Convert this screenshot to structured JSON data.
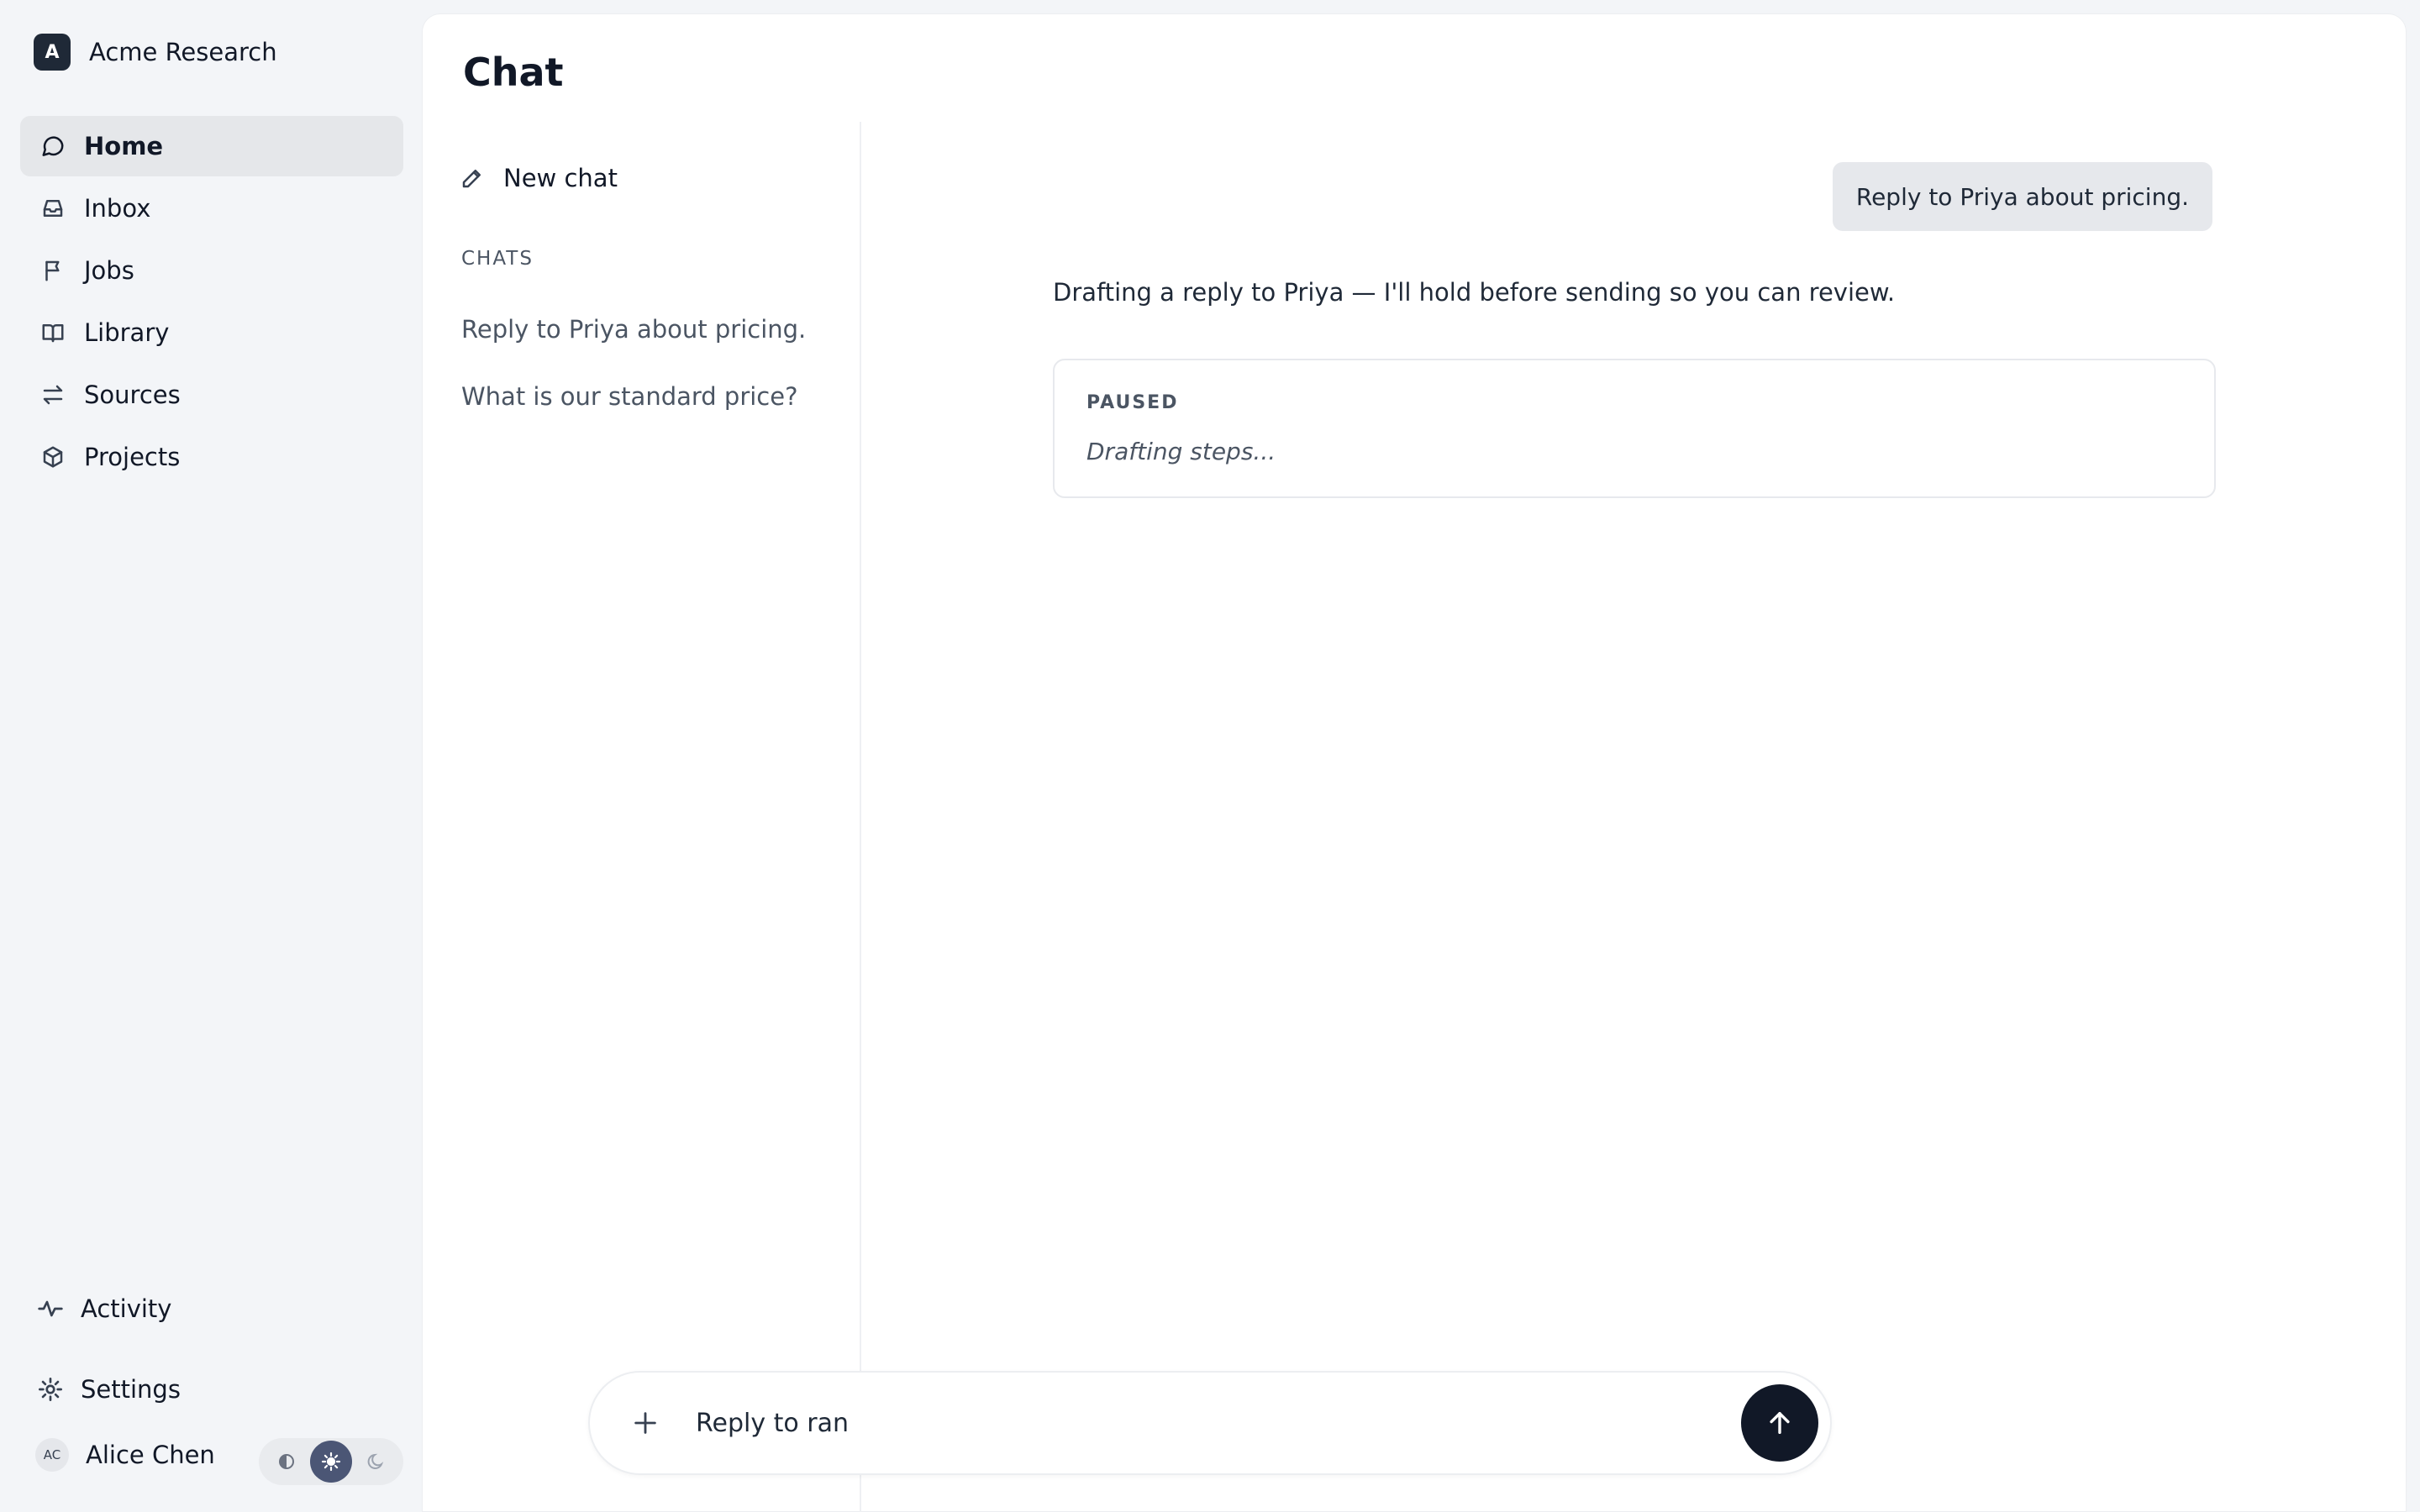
{
  "brand": {
    "logo_letter": "A",
    "name": "Acme Research"
  },
  "nav": {
    "items": [
      {
        "label": "Home",
        "icon": "message-circle-icon",
        "active": true
      },
      {
        "label": "Inbox",
        "icon": "inbox-icon"
      },
      {
        "label": "Jobs",
        "icon": "flag-icon"
      },
      {
        "label": "Library",
        "icon": "book-open-icon"
      },
      {
        "label": "Sources",
        "icon": "arrows-swap-icon"
      },
      {
        "label": "Projects",
        "icon": "box-icon"
      }
    ],
    "activity_label": "Activity",
    "settings_label": "Settings"
  },
  "user": {
    "initials": "AC",
    "name": "Alice Chen"
  },
  "theme": {
    "options": [
      "contrast",
      "light",
      "dark"
    ],
    "selected": "light"
  },
  "page": {
    "title": "Chat"
  },
  "chat_list": {
    "new_chat_label": "New chat",
    "heading": "CHATS",
    "items": [
      {
        "label": "Reply to Priya about pricing."
      },
      {
        "label": "What is our standard price?"
      }
    ]
  },
  "conversation": {
    "user_message": "Reply to Priya about pricing.",
    "assistant_message": "Drafting a reply to Priya — I'll hold before sending so you can review.",
    "status": {
      "label": "PAUSED",
      "text": "Drafting steps..."
    }
  },
  "composer": {
    "value": "Reply to ran",
    "placeholder": ""
  },
  "colors": {
    "accent_dark": "#111827",
    "theme_active": "#4b5675",
    "sidebar_bg": "#f3f5f8"
  }
}
